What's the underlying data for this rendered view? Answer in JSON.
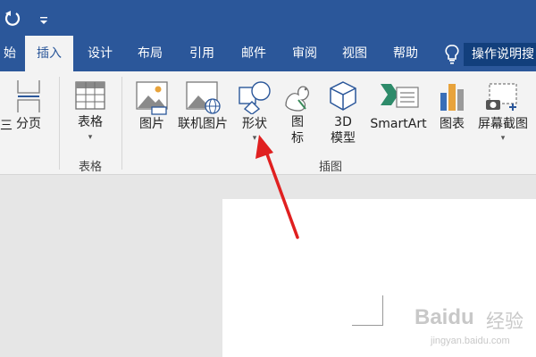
{
  "colors": {
    "brand": "#2b579a",
    "ribbon": "#f3f3f3",
    "arrow": "#e02020"
  },
  "titlebar": {
    "undo_icon": "undo-icon",
    "qat_glyph": "▾"
  },
  "tabs": [
    {
      "label": "始"
    },
    {
      "label": "插入",
      "active": true
    },
    {
      "label": "设计"
    },
    {
      "label": "布局"
    },
    {
      "label": "引用"
    },
    {
      "label": "邮件"
    },
    {
      "label": "审阅"
    },
    {
      "label": "视图"
    },
    {
      "label": "帮助"
    }
  ],
  "tell_me": {
    "icon": "lightbulb-icon",
    "text": "操作说明搜"
  },
  "ribbon": {
    "pages_group": {
      "page_break_label": "分页",
      "left_edge_label": "三"
    },
    "table_group": {
      "table_label": "表格",
      "group_label": "表格"
    },
    "illustrations": {
      "picture_label": "图片",
      "online_picture_label": "联机图片",
      "shapes_label": "形状",
      "icons_label_line1": "图",
      "icons_label_line2": "标",
      "model3d_line1": "3D",
      "model3d_line2": "模型",
      "smartart_label": "SmartArt",
      "chart_label": "图表",
      "screenshot_label": "屏幕截图",
      "group_label": "插图"
    },
    "dropdown_caret": "▾"
  },
  "watermark": {
    "brand": "Baidu",
    "cn": "经验",
    "url": "jingyan.baidu.com"
  }
}
